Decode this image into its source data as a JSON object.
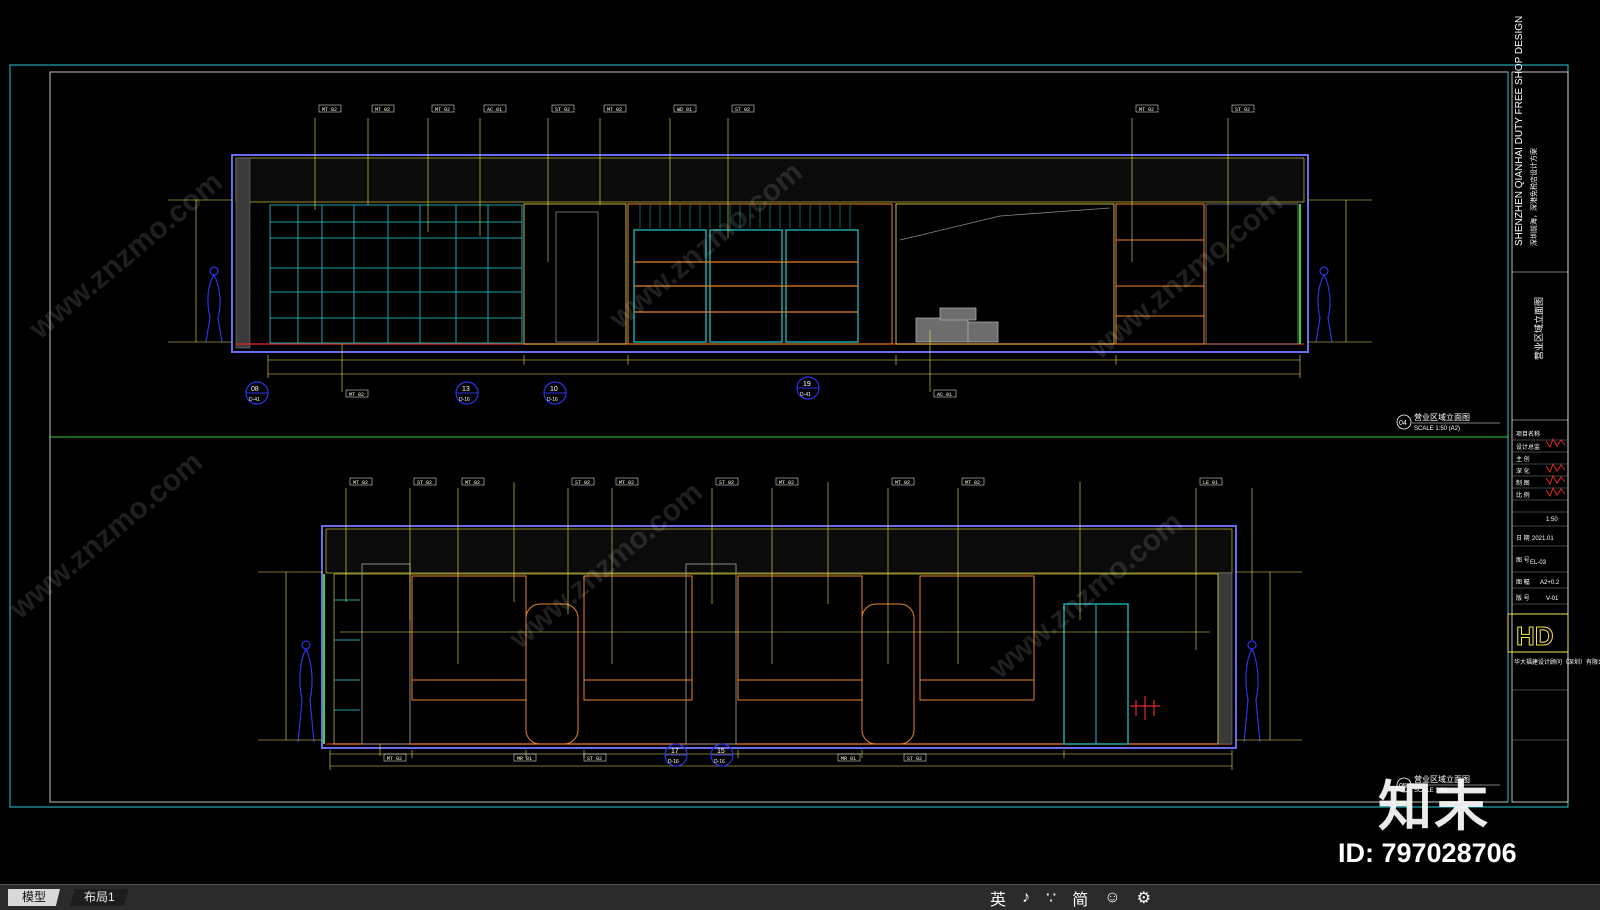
{
  "drawing": {
    "upper_title": "营业区域立面图",
    "upper_scale": "SCALE 1:50 (A2)",
    "upper_index": "04",
    "lower_title": "营业区域立面图",
    "lower_scale": "SCALE 1:50",
    "lower_index": "05",
    "upper_markers": [
      "08",
      "13",
      "10",
      "19"
    ],
    "upper_marker_subs": [
      "D-41",
      "D-16",
      "D-16",
      "D-41"
    ],
    "lower_markers": [
      "17",
      "15"
    ],
    "lower_marker_subs": [
      "D-16",
      "D-16"
    ],
    "upper_tags": [
      "MT 02",
      "MT 02",
      "MT 02",
      "AC 01",
      "ST 02",
      "MT 02",
      "WD 01",
      "ST 02",
      "MT 02",
      "ST 02"
    ],
    "lower_tags": [
      "MT 02",
      "ST 02",
      "MT 02",
      "ST 02",
      "MT 02",
      "ST 02",
      "MT 02",
      "MT 02",
      "MT 02",
      "LE 01"
    ],
    "upper_bottom_tags": [
      "MT 02",
      "AC 01"
    ],
    "lower_bottom_tags": [
      "MT 02",
      "MR 01",
      "ST 02",
      "MR 01",
      "ST 02"
    ]
  },
  "title_block": {
    "project_en": "SHENZHEN QIANHAI DUTY FREE SHOP DESIGN",
    "project_cn": "深圳前海，深港免税店设计方案",
    "sheet_name": "营业区域立面图",
    "date": "2021.01",
    "sheet_no": "EL-03",
    "paper": "A2+0.2",
    "rev": "V-01",
    "logo": "HD",
    "company": "华大福建设计顾问（深圳）有限公司",
    "field_labels": [
      "项目名称",
      "设计总监",
      "主 创",
      "深 化",
      "制 图",
      "比 例",
      "日 期",
      "图 号",
      "图 幅",
      "版 号"
    ],
    "scale_value": "1:50"
  },
  "tabs": [
    {
      "label": "模型"
    },
    {
      "label": "布局1"
    }
  ],
  "ime": {
    "items": [
      "英",
      "♪",
      "∵",
      "简",
      "☺",
      "⚙"
    ]
  },
  "watermark": {
    "logo_text": "知末",
    "id_text": "ID: 797028706",
    "diagonal_text": "www.znzmo.com"
  },
  "colors": {
    "background": "#000000",
    "frame_cyan": "#27c8d8",
    "frame_blue": "#6a6cf0",
    "yellow": "#f3e64a",
    "orange": "#e8842a",
    "green": "#3cd13c",
    "red": "#e02a2a",
    "teal": "#1aa6a6",
    "figure_blue": "#2a35e6"
  }
}
